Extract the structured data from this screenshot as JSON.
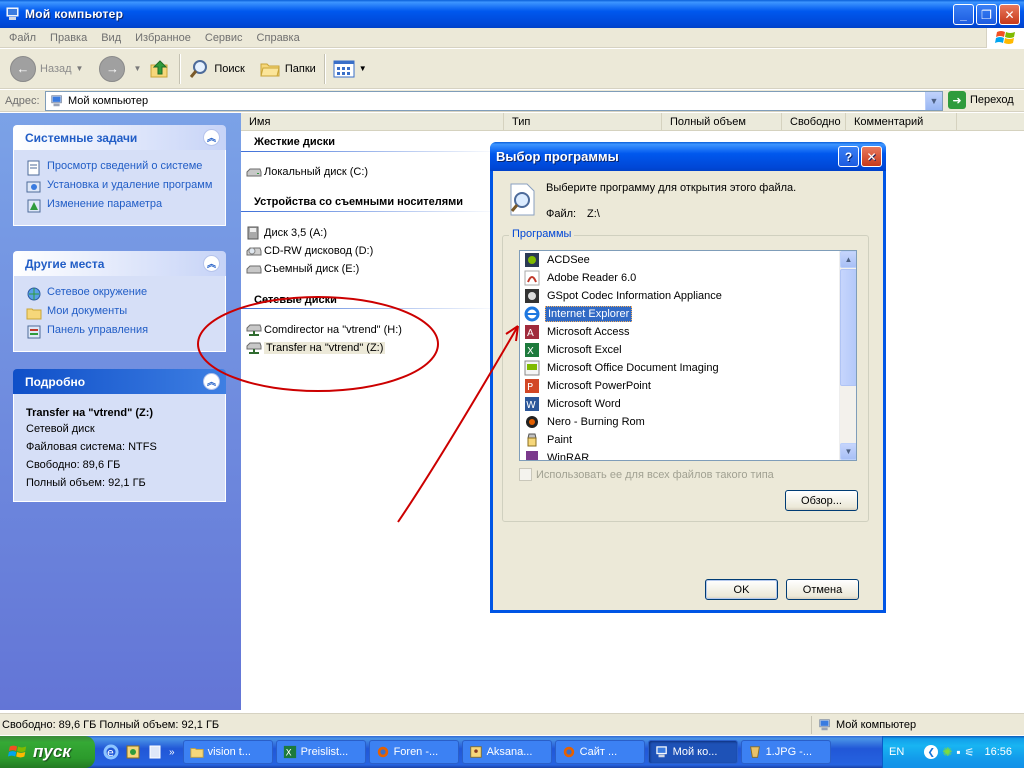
{
  "window": {
    "title": "Мой компьютер",
    "menu": [
      "Файл",
      "Правка",
      "Вид",
      "Избранное",
      "Сервис",
      "Справка"
    ]
  },
  "toolbar": {
    "back_label": "Назад",
    "search_label": "Поиск",
    "folders_label": "Папки"
  },
  "address": {
    "label": "Адрес:",
    "value": "Мой компьютер",
    "go_label": "Переход"
  },
  "tasks": {
    "system": {
      "title": "Системные задачи",
      "items": [
        "Просмотр сведений о системе",
        "Установка и удаление программ",
        "Изменение параметра"
      ]
    },
    "places": {
      "title": "Другие места",
      "items": [
        "Сетевое окружение",
        "Мои документы",
        "Панель управления"
      ]
    },
    "details": {
      "title": "Подробно",
      "name": "Transfer на \"vtrend\" (Z:)",
      "type": "Сетевой диск",
      "fs": "Файловая система: NTFS",
      "free": "Свободно: 89,6 ГБ",
      "total": "Полный объем: 92,1 ГБ"
    }
  },
  "columns": [
    "Имя",
    "Тип",
    "Полный объем",
    "Свободно",
    "Комментарий"
  ],
  "groups": {
    "hard": {
      "title": "Жесткие диски",
      "items": [
        "Локальный диск (C:)"
      ]
    },
    "removable": {
      "title": "Устройства со съемными носителями",
      "items": [
        "Диск 3,5 (A:)",
        "CD-RW дисковод (D:)",
        "Съемный диск (E:)"
      ]
    },
    "network": {
      "title": "Сетевые диски",
      "items": [
        "Comdirector на \"vtrend\" (H:)",
        "Transfer на \"vtrend\" (Z:)"
      ]
    }
  },
  "status": {
    "left": "Свободно: 89,6 ГБ Полный объем: 92,1 ГБ",
    "right": "Мой компьютер"
  },
  "dialog": {
    "title": "Выбор программы",
    "prompt": "Выберите программу для открытия этого файла.",
    "file_label": "Файл:",
    "file_value": "Z:\\",
    "group_label": "Программы",
    "programs": [
      "ACDSee",
      "Adobe Reader 6.0",
      "GSpot Codec Information Appliance",
      "Internet Explorer",
      "Microsoft Access",
      "Microsoft Excel",
      "Microsoft Office Document Imaging",
      "Microsoft PowerPoint",
      "Microsoft Word",
      "Nero - Burning Rom",
      "Paint",
      "WinRAR"
    ],
    "selected_index": 3,
    "checkbox_label": "Использовать ее для всех файлов такого типа",
    "browse_label": "Обзор...",
    "ok_label": "OK",
    "cancel_label": "Отмена"
  },
  "taskbar": {
    "start_label": "пуск",
    "tasks": [
      "vision t...",
      "Preislist...",
      "Foren -...",
      "Aksana...",
      "Сайт ...",
      "Мой ко...",
      "1.JPG -..."
    ],
    "active_index": 5,
    "lang": "EN",
    "clock": "16:56"
  },
  "colors": {
    "accent": "#0055e5",
    "selection": "#316ac5",
    "annotation": "#cc0000"
  }
}
